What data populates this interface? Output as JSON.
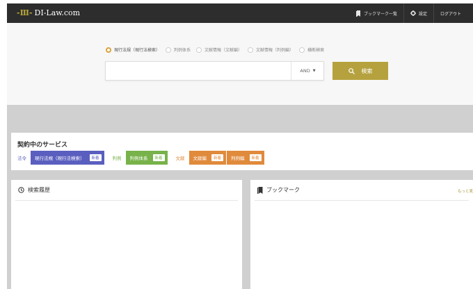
{
  "header": {
    "logo_text": "DI-Law.com",
    "nav": [
      {
        "label": "ブックマーク一覧",
        "icon": "bookmark-icon"
      },
      {
        "label": "設定",
        "icon": "gear-icon"
      },
      {
        "label": "ログアウト",
        "icon": ""
      }
    ]
  },
  "search": {
    "modes": [
      {
        "label": "現行法規（現行法検索）",
        "selected": true
      },
      {
        "label": "判例体系",
        "selected": false
      },
      {
        "label": "文献情報（文献編）",
        "selected": false
      },
      {
        "label": "文献情報（判例編）",
        "selected": false
      },
      {
        "label": "横断検索",
        "selected": false
      }
    ],
    "input_value": "",
    "operator": "AND",
    "button_label": "検索",
    "button_icon": "search-icon"
  },
  "services": {
    "title": "契約中のサービス",
    "new_badge": "新着",
    "categories": [
      {
        "label": "法令",
        "color": "#5a5fbf",
        "items": [
          "現行法規（現行法検索）"
        ]
      },
      {
        "label": "判例",
        "color": "#77b24a",
        "items": [
          "判例体系"
        ]
      },
      {
        "label": "文献",
        "color": "#e08a3c",
        "items": [
          "文献編",
          "判例編"
        ]
      }
    ]
  },
  "history": {
    "title": "検索履歴",
    "icon": "clock-icon"
  },
  "bookmarks": {
    "title": "ブックマーク",
    "icon": "bookmark-icon",
    "more_label": "もっと見"
  },
  "colors": {
    "accent": "#b5a23e",
    "header_bg": "#2d2d2d",
    "radio_selected": "#d9a23a"
  }
}
